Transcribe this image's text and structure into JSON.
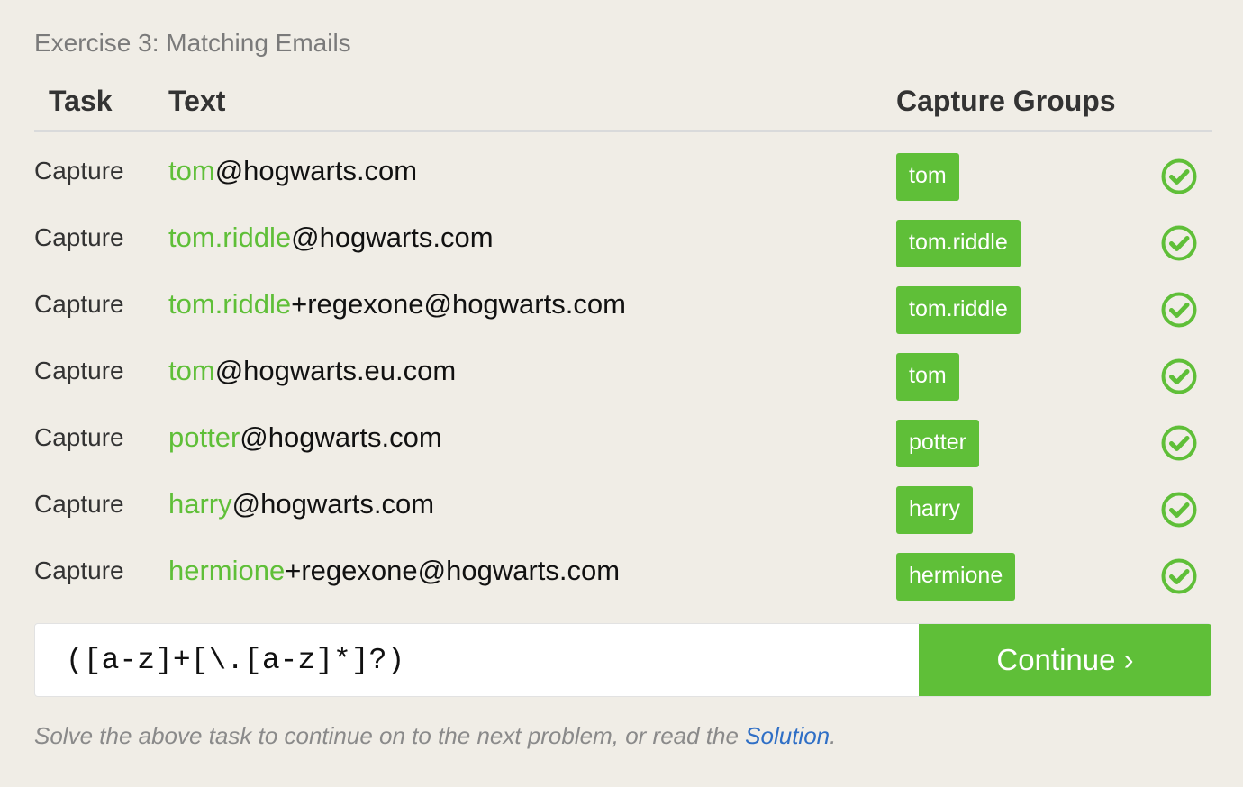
{
  "exercise_title": "Exercise 3: Matching Emails",
  "columns": {
    "task": "Task",
    "text": "Text",
    "capture_groups": "Capture Groups"
  },
  "rows": [
    {
      "task": "Capture",
      "match": "tom",
      "rest": "@hogwarts.com",
      "group": "tom",
      "status_icon": "check-circle-icon"
    },
    {
      "task": "Capture",
      "match": "tom.riddle",
      "rest": "@hogwarts.com",
      "group": "tom.riddle",
      "status_icon": "check-circle-icon"
    },
    {
      "task": "Capture",
      "match": "tom.riddle",
      "rest": "+regexone@hogwarts.com",
      "group": "tom.riddle",
      "status_icon": "check-circle-icon"
    },
    {
      "task": "Capture",
      "match": "tom",
      "rest": "@hogwarts.eu.com",
      "group": "tom",
      "status_icon": "check-circle-icon"
    },
    {
      "task": "Capture",
      "match": "potter",
      "rest": "@hogwarts.com",
      "group": "potter",
      "status_icon": "check-circle-icon"
    },
    {
      "task": "Capture",
      "match": "harry",
      "rest": "@hogwarts.com",
      "group": "harry",
      "status_icon": "check-circle-icon"
    },
    {
      "task": "Capture",
      "match": "hermione",
      "rest": "+regexone@hogwarts.com",
      "group": "hermione",
      "status_icon": "check-circle-icon"
    }
  ],
  "regex_input": {
    "value": "([a-z]+[\\.[a-z]*]?)"
  },
  "continue_button": "Continue ›",
  "footer": {
    "prefix": "Solve the above task to continue on to the next problem, or read the ",
    "link": "Solution",
    "suffix": "."
  },
  "colors": {
    "background": "#f0ede6",
    "accent_green": "#5fbf38",
    "link_blue": "#2f6fc6"
  }
}
